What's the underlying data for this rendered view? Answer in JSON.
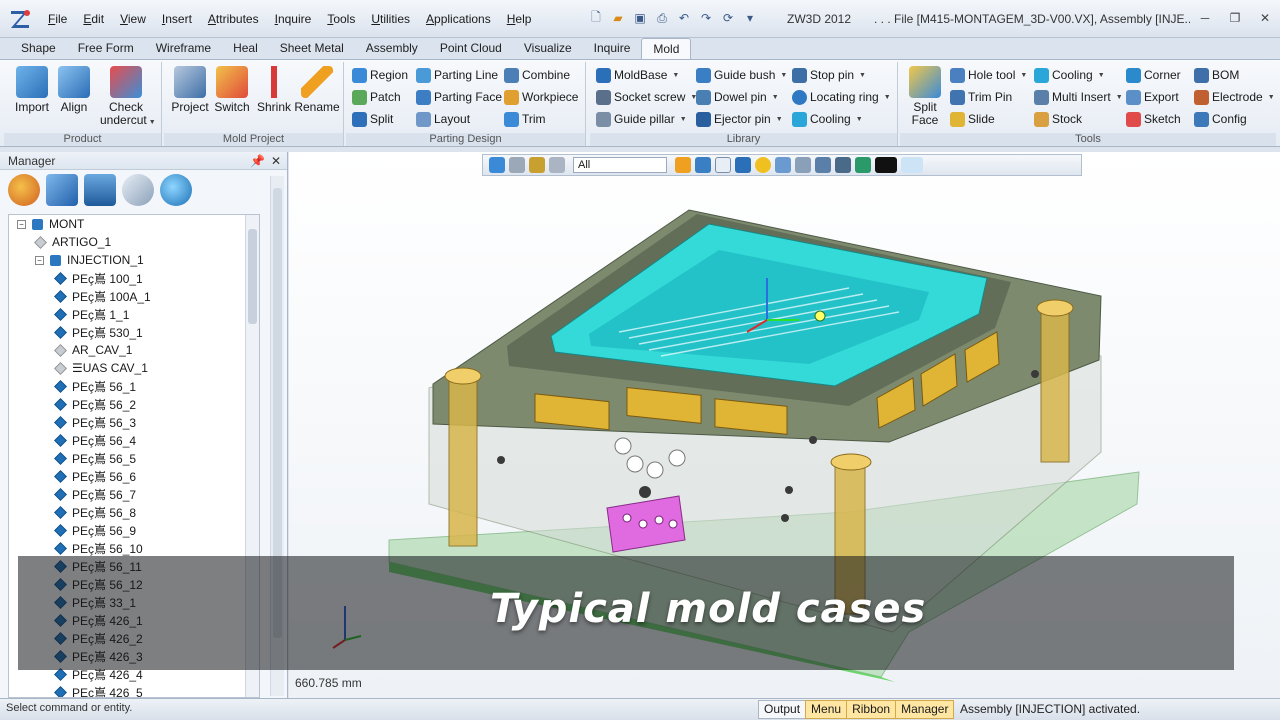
{
  "menu": [
    "File",
    "Edit",
    "View",
    "Insert",
    "Attributes",
    "Inquire",
    "Tools",
    "Utilities",
    "Applications",
    "Help"
  ],
  "app_title": "ZW3D 2012",
  "file_title": ". . . File [M415-MONTAGEM_3D-V00.VX], Assembly [INJE...",
  "ribbon_tabs": [
    "Shape",
    "Free Form",
    "Wireframe",
    "Heal",
    "Sheet Metal",
    "Assembly",
    "Point Cloud",
    "Visualize",
    "Inquire",
    "Mold"
  ],
  "ribbon_active": "Mold",
  "groups": {
    "product": {
      "label": "Product",
      "import": "Import",
      "align": "Align",
      "check_line1": "Check",
      "check_line2": "undercut"
    },
    "mold_project": {
      "label": "Mold Project",
      "project": "Project",
      "switch": "Switch",
      "shrink": "Shrink",
      "rename": "Rename"
    },
    "parting_design": {
      "label": "Parting Design",
      "region": "Region",
      "patch": "Patch",
      "split": "Split",
      "parting_line": "Parting Line",
      "parting_face": "Parting Face",
      "layout": "Layout",
      "combine": "Combine",
      "workpiece": "Workpiece",
      "trim": "Trim"
    },
    "library": {
      "label": "Library",
      "moldbase": "MoldBase",
      "socket_screw": "Socket screw",
      "guide_pillar": "Guide pillar",
      "guide_bush": "Guide bush",
      "dowel_pin": "Dowel pin",
      "ejector_pin": "Ejector pin",
      "stop_pin": "Stop pin",
      "locating_ring": "Locating ring",
      "cooling": "Cooling"
    },
    "tools": {
      "label": "Tools",
      "split_line1": "Split",
      "split_line2": "Face",
      "hole_tool": "Hole tool",
      "trim_pin": "Trim Pin",
      "slide": "Slide",
      "cooling": "Cooling",
      "multi_insert": "Multi Insert",
      "stock": "Stock",
      "corner": "Corner",
      "export": "Export",
      "sketch": "Sketch",
      "bom": "BOM",
      "electrode": "Electrode",
      "config": "Config"
    }
  },
  "manager": {
    "title": "Manager",
    "tree": [
      {
        "label": "MONT",
        "level": 0,
        "toggle": "-",
        "icon": "asm"
      },
      {
        "label": "ARTIGO_1",
        "level": 1,
        "toggle": "",
        "icon": "light"
      },
      {
        "label": "INJECTION_1",
        "level": 1,
        "toggle": "-",
        "icon": "asm"
      },
      {
        "label": "PEç嶌 100_1",
        "level": 2,
        "icon": "cube"
      },
      {
        "label": "PEç嶌 100A_1",
        "level": 2,
        "icon": "cube"
      },
      {
        "label": "PEç嶌 1_1",
        "level": 2,
        "icon": "cube"
      },
      {
        "label": "PEç嶌 530_1",
        "level": 2,
        "icon": "cube"
      },
      {
        "label": "AR_CAV_1",
        "level": 2,
        "icon": "light"
      },
      {
        "label": "☰UAS CAV_1",
        "level": 2,
        "icon": "light"
      },
      {
        "label": "PEç嶌 56_1",
        "level": 2,
        "icon": "cube"
      },
      {
        "label": "PEç嶌 56_2",
        "level": 2,
        "icon": "cube"
      },
      {
        "label": "PEç嶌 56_3",
        "level": 2,
        "icon": "cube"
      },
      {
        "label": "PEç嶌 56_4",
        "level": 2,
        "icon": "cube"
      },
      {
        "label": "PEç嶌 56_5",
        "level": 2,
        "icon": "cube"
      },
      {
        "label": "PEç嶌 56_6",
        "level": 2,
        "icon": "cube"
      },
      {
        "label": "PEç嶌 56_7",
        "level": 2,
        "icon": "cube"
      },
      {
        "label": "PEç嶌 56_8",
        "level": 2,
        "icon": "cube"
      },
      {
        "label": "PEç嶌 56_9",
        "level": 2,
        "icon": "cube"
      },
      {
        "label": "PEç嶌 56_10",
        "level": 2,
        "icon": "cube"
      },
      {
        "label": "PEç嶌 56_11",
        "level": 2,
        "icon": "cube"
      },
      {
        "label": "PEç嶌 56_12",
        "level": 2,
        "icon": "cube"
      },
      {
        "label": "PEç嶌 33_1",
        "level": 2,
        "icon": "cube"
      },
      {
        "label": "PEç嶌 426_1",
        "level": 2,
        "icon": "cube"
      },
      {
        "label": "PEç嶌 426_2",
        "level": 2,
        "icon": "cube"
      },
      {
        "label": "PEç嶌 426_3",
        "level": 2,
        "icon": "cube"
      },
      {
        "label": "PEç嶌 426_4",
        "level": 2,
        "icon": "cube"
      },
      {
        "label": "PEç嶌 426_5",
        "level": 2,
        "icon": "cube"
      }
    ]
  },
  "viewport": {
    "filter": "All",
    "measure": "660.785 mm",
    "caption": "Typical mold cases"
  },
  "status": {
    "prompt": "Select command or entity.",
    "tabs": [
      "Output",
      "Menu",
      "Ribbon",
      "Manager"
    ],
    "message": "Assembly [INJECTION] activated."
  },
  "colors": {
    "cavity": "#2ee6e6",
    "plate": "#7d8a6e",
    "slide": "#e06be0",
    "clamp": "#e0b434",
    "base": "#5fd15f",
    "pillar": "#d8b64c"
  }
}
